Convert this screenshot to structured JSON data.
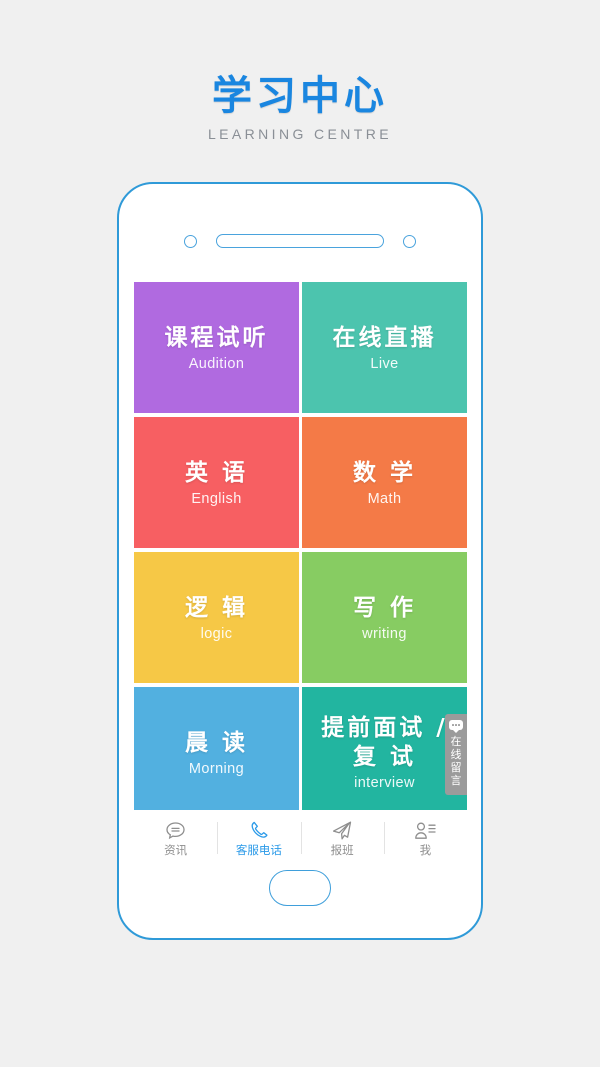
{
  "header": {
    "brand_cn": "学习中心",
    "brand_en": "LEARNING CENTRE",
    "brand_color": "#1a86e0"
  },
  "phone": {
    "frame_color": "#2f9ad8",
    "camera_icon": "camera-dot",
    "speaker_icon": "speaker-bar",
    "home_button_icon": "home-button"
  },
  "side_tab": {
    "icon": "chat-bubble-icon",
    "label": "在线留言",
    "background": "#9b9b9b"
  },
  "grid": {
    "tiles": [
      {
        "cn": "课程试听",
        "en": "Audition",
        "color": "#b06ae0",
        "name": "tile-audition"
      },
      {
        "cn": "在线直播",
        "en": "Live",
        "color": "#4cc4ae",
        "name": "tile-live"
      },
      {
        "cn": "英 语",
        "en": "English",
        "color": "#f75f62",
        "name": "tile-english"
      },
      {
        "cn": "数 学",
        "en": "Math",
        "color": "#f47a47",
        "name": "tile-math"
      },
      {
        "cn": "逻 辑",
        "en": "logic",
        "color": "#f6c846",
        "name": "tile-logic"
      },
      {
        "cn": "写 作",
        "en": "writing",
        "color": "#87cc62",
        "name": "tile-writing"
      },
      {
        "cn": "晨 读",
        "en": "Morning",
        "color": "#52b0e0",
        "name": "tile-morning"
      },
      {
        "cn": "提前面试 /\n复 试",
        "en": "interview",
        "color": "#22b5a0",
        "name": "tile-interview"
      }
    ]
  },
  "nav": {
    "active_color": "#2b9ae8",
    "inactive_color": "#8e8e8e",
    "items": [
      {
        "label": "资讯",
        "icon": "chat-bubble-icon",
        "active": false
      },
      {
        "label": "客服电话",
        "icon": "phone-icon",
        "active": true
      },
      {
        "label": "报班",
        "icon": "paper-plane-icon",
        "active": false
      },
      {
        "label": "我",
        "icon": "person-icon",
        "active": false
      }
    ]
  }
}
